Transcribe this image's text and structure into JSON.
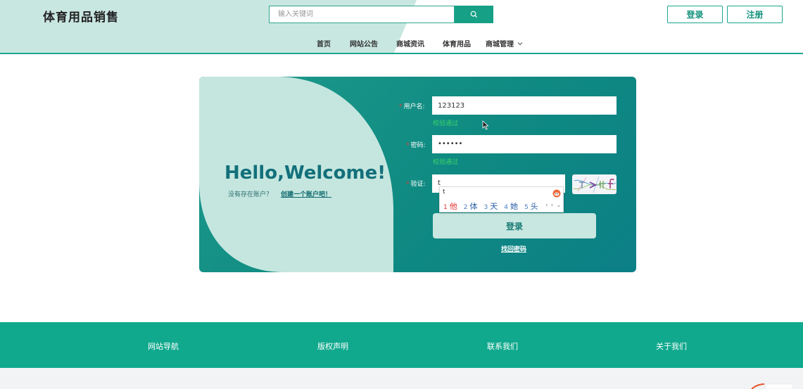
{
  "header": {
    "logo": "体育用品销售",
    "search_placeholder": "输入关键词",
    "login_label": "登录",
    "register_label": "注册"
  },
  "nav": {
    "items": [
      "首页",
      "网站公告",
      "商城资讯",
      "体育用品",
      "商城管理"
    ]
  },
  "welcome": {
    "title": "Hello,Welcome!",
    "no_account": "没有存在账户？",
    "create_link": "创建一个账户吧！"
  },
  "form": {
    "username_label": "用户名:",
    "username_value": "123123",
    "username_hint": "校验通过",
    "password_label": "密码:",
    "password_value": "••••••",
    "password_hint": "校验通过",
    "captcha_label": "验证:",
    "captcha_value": "t",
    "submit_label": "登录",
    "forgot_label": "找回密码"
  },
  "ime": {
    "composition": "t",
    "candidates": [
      {
        "num": "1",
        "text": "他"
      },
      {
        "num": "2",
        "text": "体"
      },
      {
        "num": "3",
        "text": "天"
      },
      {
        "num": "4",
        "text": "她"
      },
      {
        "num": "5",
        "text": "头"
      }
    ]
  },
  "footer": {
    "items": [
      "网站导航",
      "版权声明",
      "联系我们",
      "关于我们"
    ]
  },
  "colors": {
    "accent": "#1aa68e",
    "footer": "#10a98d",
    "card_light": "#c5e6df",
    "hint": "#39d36a"
  }
}
